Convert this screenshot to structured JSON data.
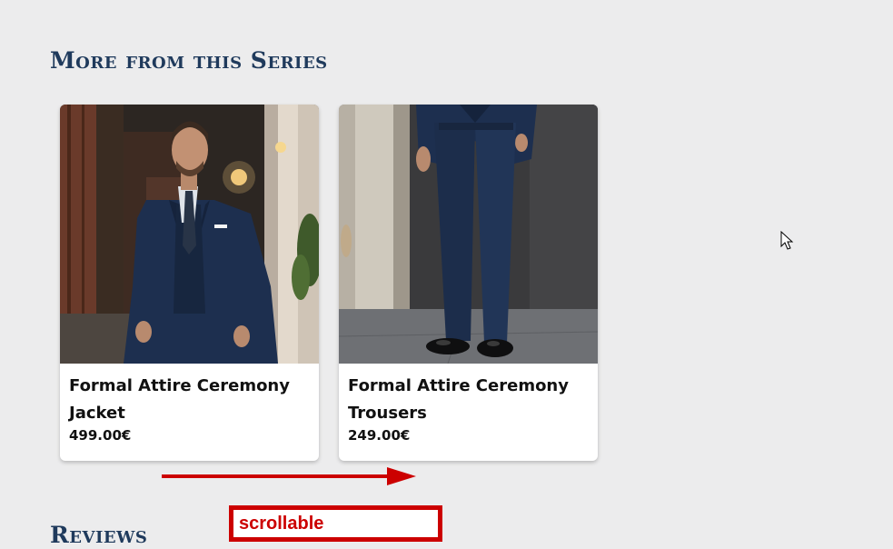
{
  "series_section": {
    "title": "More from this Series",
    "products": [
      {
        "name": "Formal Attire Ceremony Jacket",
        "price": "499.00€",
        "image": "man-in-navy-three-piece-suit"
      },
      {
        "name": "Formal Attire Ceremony Trousers",
        "price": "249.00€",
        "image": "navy-suit-trousers-with-black-shoes"
      }
    ]
  },
  "annotation": {
    "scroll_label": "scrollable",
    "arrow_direction": "right",
    "color": "#cc0000"
  },
  "reviews_section": {
    "title": "Reviews"
  },
  "colors": {
    "background": "#ececed",
    "heading": "#1f3a5c",
    "card_background": "#ffffff",
    "suit_navy": "#1d2f4f"
  }
}
